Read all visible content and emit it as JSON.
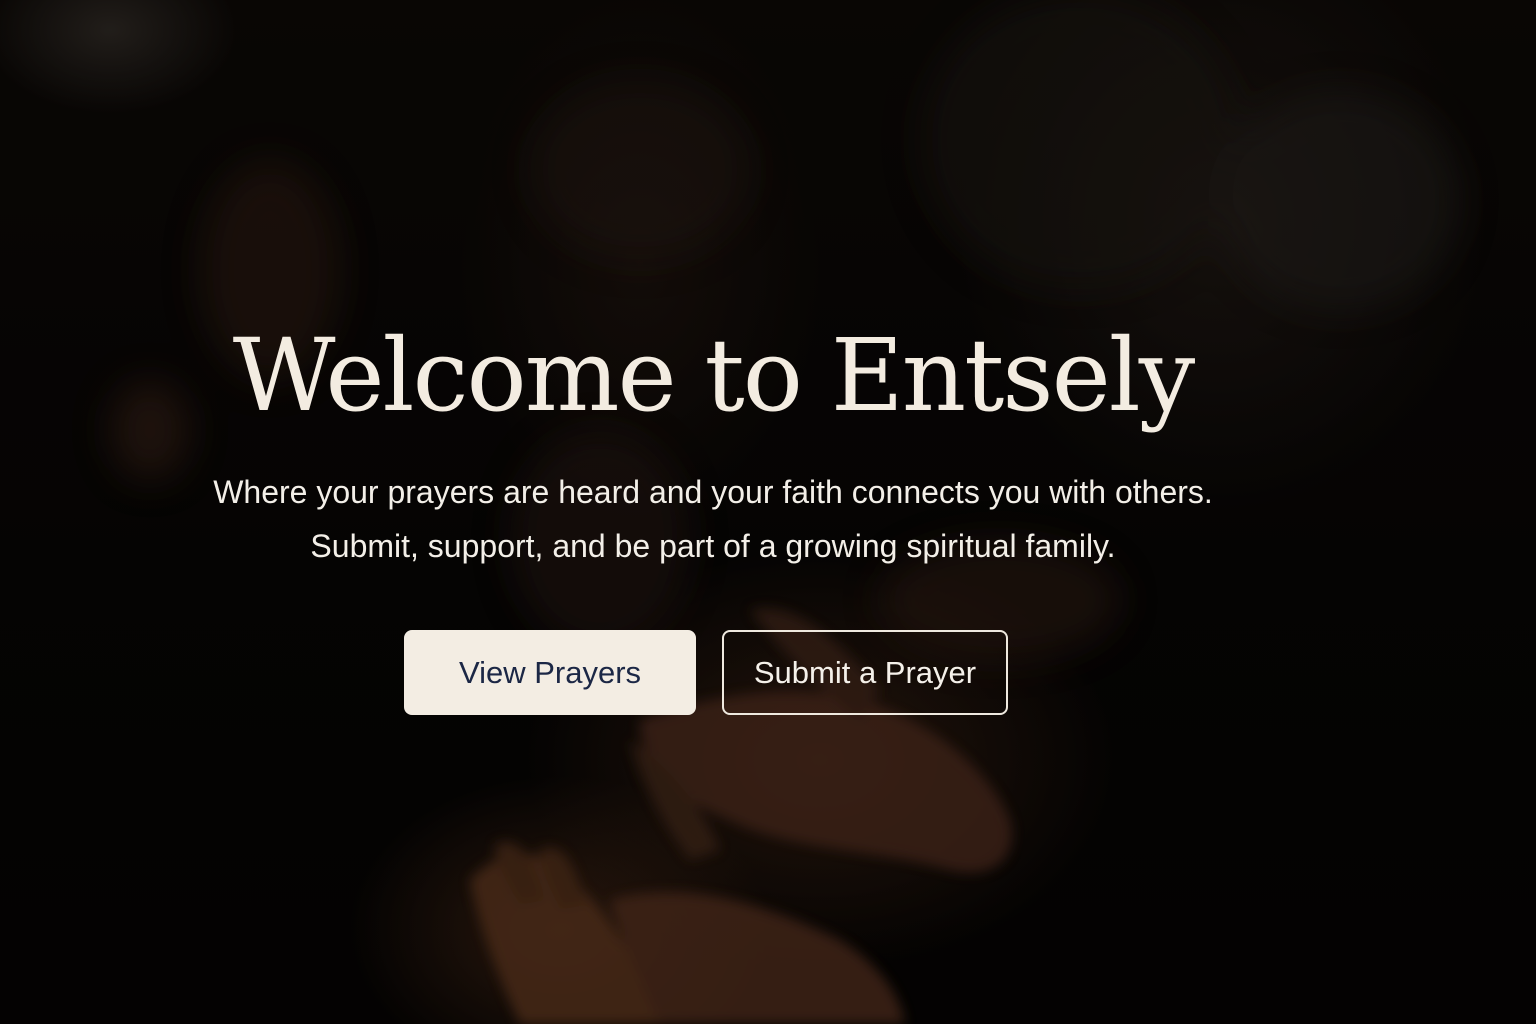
{
  "hero": {
    "title": "Welcome to Entsely",
    "subtitle_line1": "Where your prayers are heard and your faith connects you with others.",
    "subtitle_line2": "Submit, support, and be part of a growing spiritual family."
  },
  "actions": {
    "view_prayers_label": "View Prayers",
    "submit_prayer_label": "Submit a Prayer"
  },
  "colors": {
    "title_text": "#f3ece1",
    "primary_button_bg": "#f3ede3",
    "primary_button_text": "#1b2745",
    "secondary_button_border": "#efe9df",
    "background": "#070504"
  }
}
